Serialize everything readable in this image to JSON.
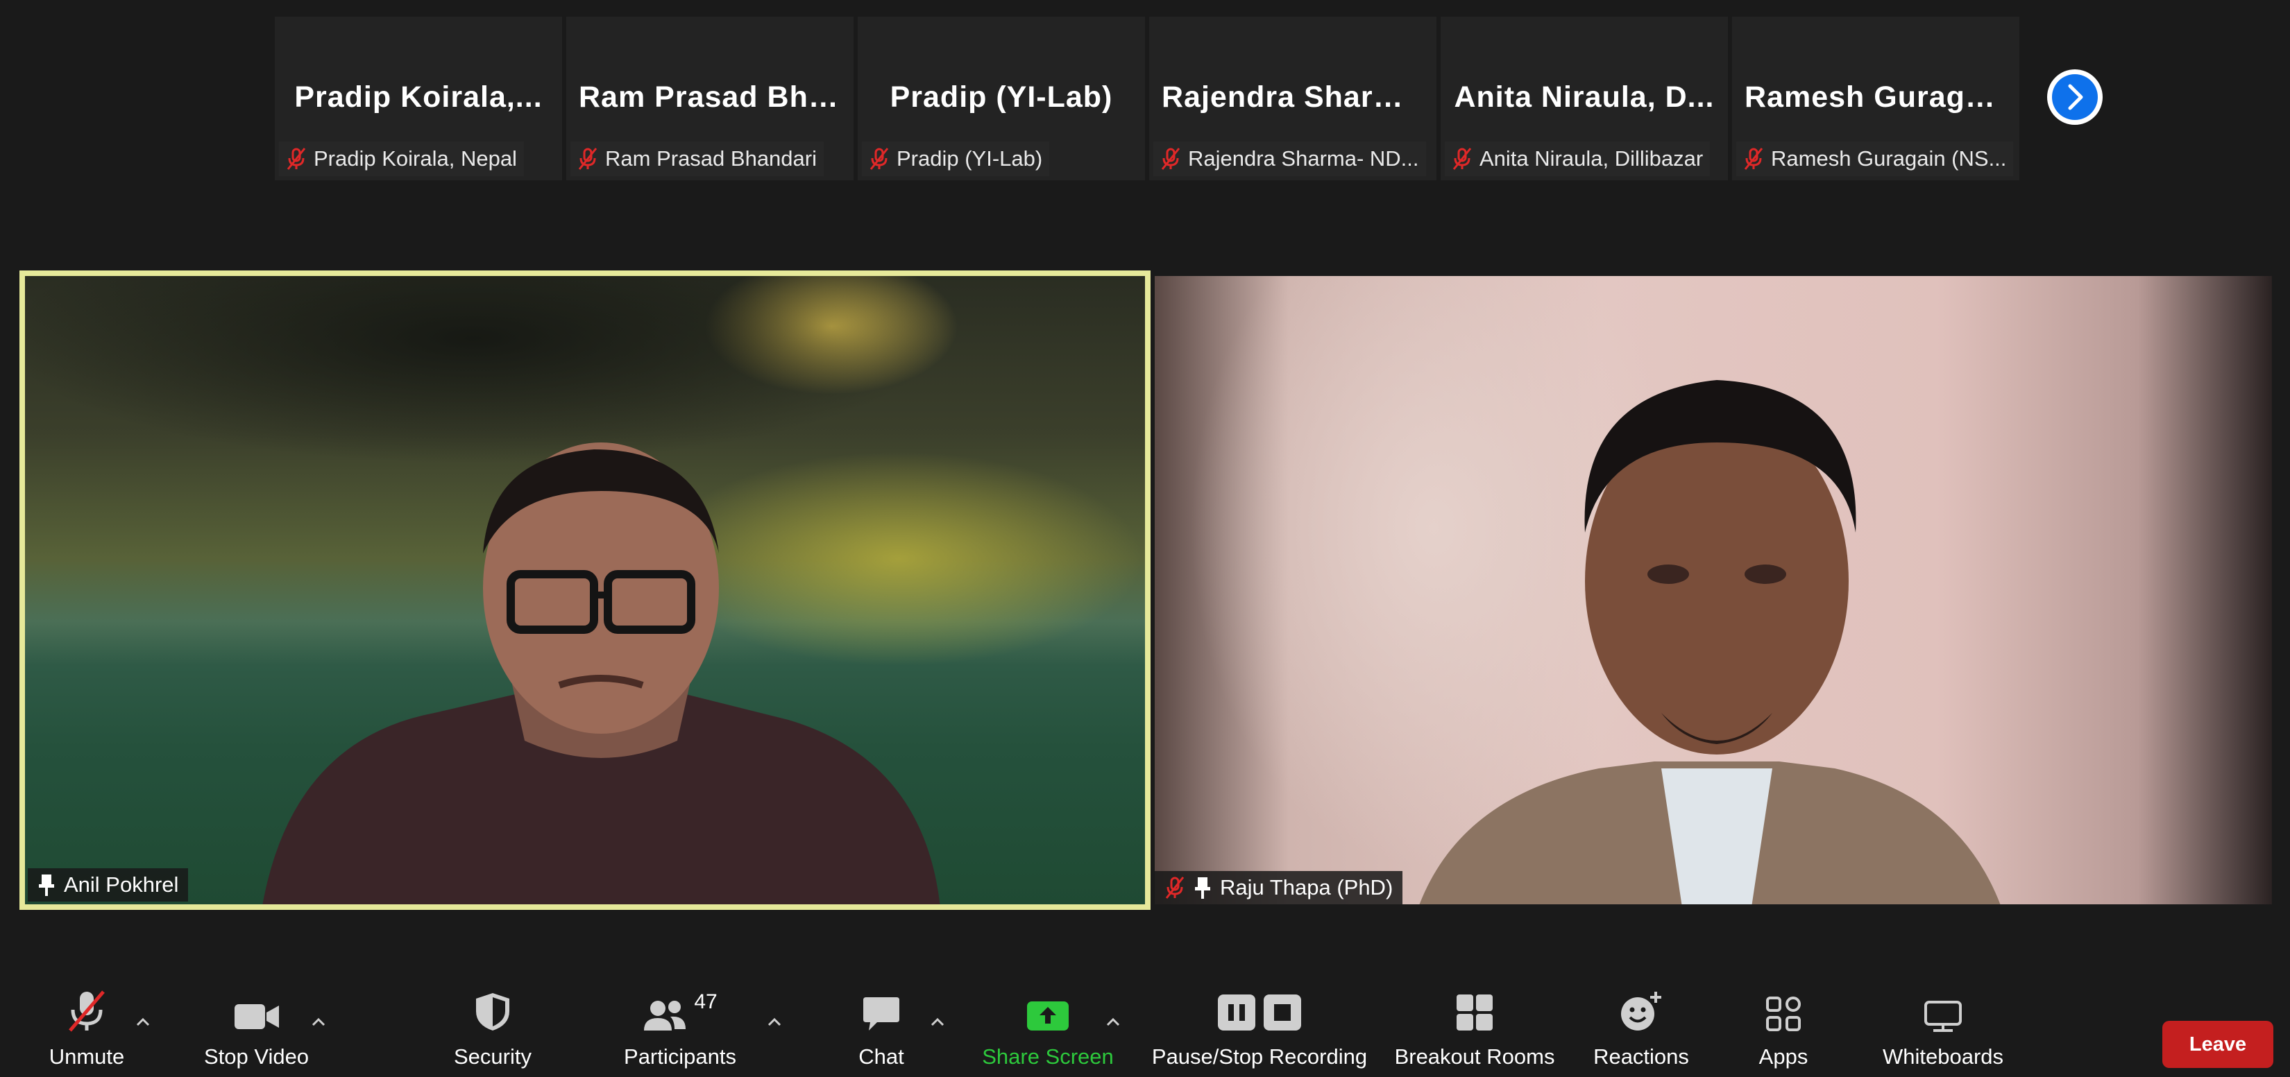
{
  "thumbnails": [
    {
      "display_name": "Pradip Koirala,...",
      "label": "Pradip Koirala, Nepal"
    },
    {
      "display_name": "Ram Prasad Bha...",
      "label": "Ram Prasad Bhandari"
    },
    {
      "display_name": "Pradip (YI-Lab)",
      "label": "Pradip (YI-Lab)"
    },
    {
      "display_name": "Rajendra Sharm...",
      "label": "Rajendra Sharma- ND..."
    },
    {
      "display_name": "Anita Niraula, D...",
      "label": "Anita Niraula, Dillibazar"
    },
    {
      "display_name": "Ramesh Guraga...",
      "label": "Ramesh Guragain (NS..."
    }
  ],
  "next_page_icon": "chevron-right-icon",
  "videos": {
    "left_name": "Anil Pokhrel",
    "right_name": "Raju Thapa (PhD)"
  },
  "toolbar": {
    "unmute": "Unmute",
    "stop_video": "Stop Video",
    "security": "Security",
    "participants": "Participants",
    "participants_count": "47",
    "chat": "Chat",
    "share_screen": "Share Screen",
    "recording": "Pause/Stop Recording",
    "breakout": "Breakout Rooms",
    "reactions": "Reactions",
    "apps": "Apps",
    "whiteboards": "Whiteboards",
    "leave": "Leave"
  },
  "colors": {
    "active_speaker_border": "#e6e99a",
    "share_green": "#2dc93c",
    "leave_red": "#c41f1f",
    "accent_blue": "#0e71eb"
  }
}
